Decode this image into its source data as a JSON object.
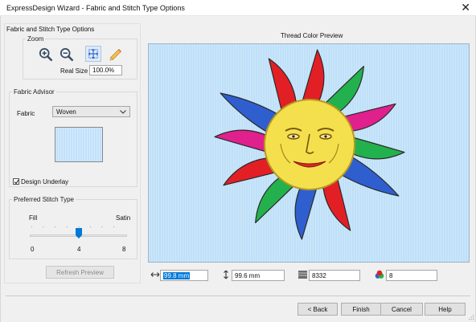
{
  "window": {
    "title": "ExpressDesign Wizard - Fabric and Stitch Type Options",
    "close_glyph": "✕"
  },
  "section_title": "Fabric and Stitch Type Options",
  "zoom": {
    "legend": "Zoom",
    "real_size_label": "Real Size",
    "real_size_value": "100.0%"
  },
  "fabric_advisor": {
    "legend": "Fabric Advisor",
    "fabric_label": "Fabric",
    "fabric_value": "Woven",
    "swatch_color": "#c2e1fa",
    "design_underlay_label": "Design Underlay",
    "design_underlay_checked": true
  },
  "stitch_type": {
    "legend": "Preferred Stitch Type",
    "left_label": "Fill",
    "right_label": "Satin",
    "tick_min": "0",
    "tick_mid": "4",
    "tick_max": "8",
    "slider_value": 4,
    "slider_max": 8
  },
  "refresh_preview_label": "Refresh Preview",
  "preview": {
    "title": "Thread Color Preview",
    "background_color": "#bfe0f8"
  },
  "stats": {
    "width_value": "99.8 mm",
    "height_value": "99.6 mm",
    "stitch_count": "8332",
    "color_count": "8"
  },
  "buttons": {
    "back": "< Back",
    "finish": "Finish",
    "cancel": "Cancel",
    "help": "Help"
  },
  "colors": {
    "ray_red": "#e31f26",
    "ray_green": "#23b14d",
    "ray_blue": "#2f5fcf",
    "ray_magenta": "#e0208d",
    "sun_face": "#f4e04d",
    "accent_blue": "#0078d7"
  },
  "icons": [
    "zoom-in-icon",
    "zoom-out-icon",
    "zoom-fit-icon",
    "measure-icon",
    "width-arrow-icon",
    "height-arrow-icon",
    "stitch-count-icon",
    "color-count-icon",
    "resize-grip-icon"
  ]
}
